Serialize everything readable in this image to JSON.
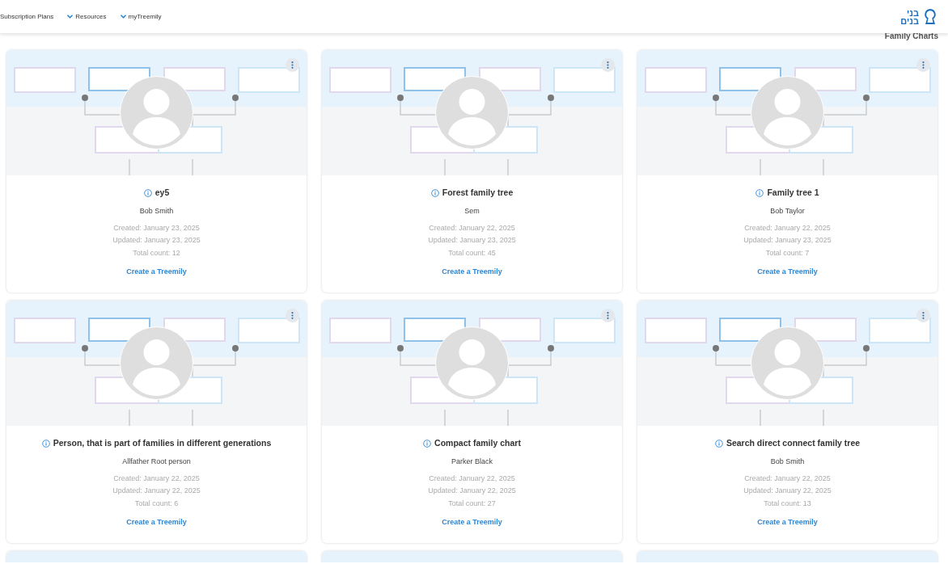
{
  "nav": [
    {
      "label": "Subscription Plans",
      "dropdown": false
    },
    {
      "label": "Resources",
      "dropdown": true
    },
    {
      "label": "myTreemily",
      "dropdown": true
    }
  ],
  "logo": {
    "lines": [
      "בני",
      "בנים"
    ]
  },
  "heading": "Family Charts",
  "cards": [
    {
      "kind": "full",
      "title": "ey5",
      "owner": "Bob Smith",
      "created": "Created: January 23, 2025",
      "updated": "Updated: January 23, 2025",
      "count": "Total count: 12",
      "action": "Create a Treemily"
    },
    {
      "kind": "full",
      "title": "Forest family tree",
      "owner": "Sem",
      "created": "Created: January 22, 2025",
      "updated": "Updated: January 23, 2025",
      "count": "Total count: 45",
      "action": "Create a Treemily"
    },
    {
      "kind": "full",
      "title": "Family tree 1",
      "owner": "Bob Taylor",
      "created": "Created: January 22, 2025",
      "updated": "Updated: January 23, 2025",
      "count": "Total count: 7",
      "action": "Create a Treemily"
    },
    {
      "kind": "full",
      "title": "Person, that is part of families in different generations",
      "owner": "Allfather Root person",
      "created": "Created: January 22, 2025",
      "updated": "Updated: January 22, 2025",
      "count": "Total count: 6",
      "action": "Create a Treemily"
    },
    {
      "kind": "full",
      "title": "Compact family chart",
      "owner": "Parker Black",
      "created": "Created: January 22, 2025",
      "updated": "Updated: January 22, 2025",
      "count": "Total count: 27",
      "action": "Create a Treemily"
    },
    {
      "kind": "full",
      "title": "Search direct connect family tree",
      "owner": "Bob Smith",
      "created": "Created: January 22, 2025",
      "updated": "Updated: January 22, 2025",
      "count": "Total count: 13",
      "action": "Create a Treemily"
    },
    {
      "kind": "preview"
    },
    {
      "kind": "preview"
    },
    {
      "kind": "preview"
    }
  ]
}
